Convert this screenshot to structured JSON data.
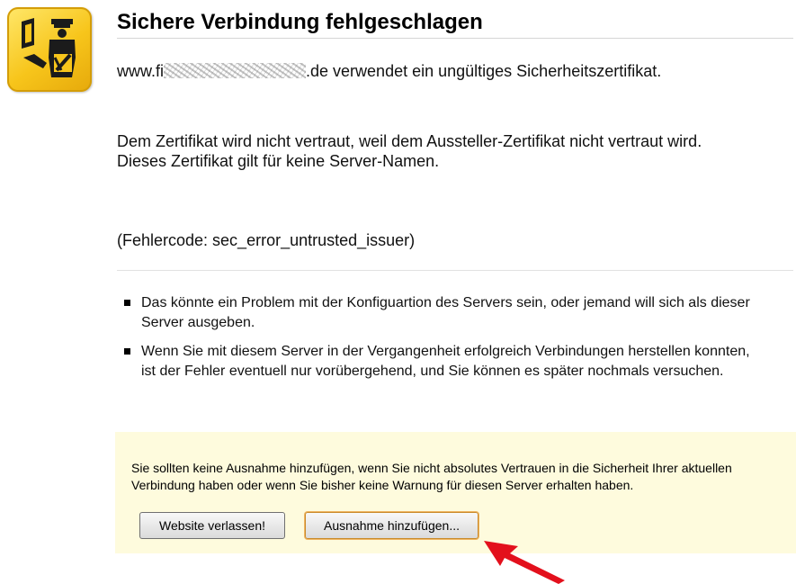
{
  "page": {
    "title": "Sichere Verbindung fehlgeschlagen",
    "host_prefix": "www.fi",
    "host_suffix": ".de verwendet ein ungültiges Sicherheitszertifikat.",
    "paragraph_2": "Dem Zertifikat wird nicht vertraut, weil dem Aussteller-Zertifikat nicht vertraut wird.",
    "paragraph_3": "Dieses Zertifikat gilt für keine Server-Namen.",
    "error_code": "(Fehlercode: sec_error_untrusted_issuer)"
  },
  "bullets": [
    "Das könnte ein Problem mit der Konfiguartion des Servers sein, oder jemand will sich als dieser Server ausgeben.",
    "Wenn Sie mit diesem Server in der Vergangenheit erfolgreich Verbindungen herstellen konnten, ist der Fehler eventuell nur vorübergehend, und Sie können es später nochmals versuchen."
  ],
  "warning": {
    "text": "Sie sollten keine Ausnahme hinzufügen, wenn Sie nicht absolutes Vertrauen in die Sicherheit Ihrer aktuellen Verbindung haben oder wenn Sie bisher keine Warnung für diesen Server erhalten haben.",
    "leave_button": "Website verlassen!",
    "add_exception_button": "Ausnahme hinzufügen..."
  },
  "icons": {
    "header_icon": "police-officer-icon",
    "annotation": "red-arrow-icon"
  },
  "colors": {
    "icon_yellow": "#f7c51b",
    "warning_background": "#fefbdd",
    "arrow_red": "#e3101c"
  }
}
